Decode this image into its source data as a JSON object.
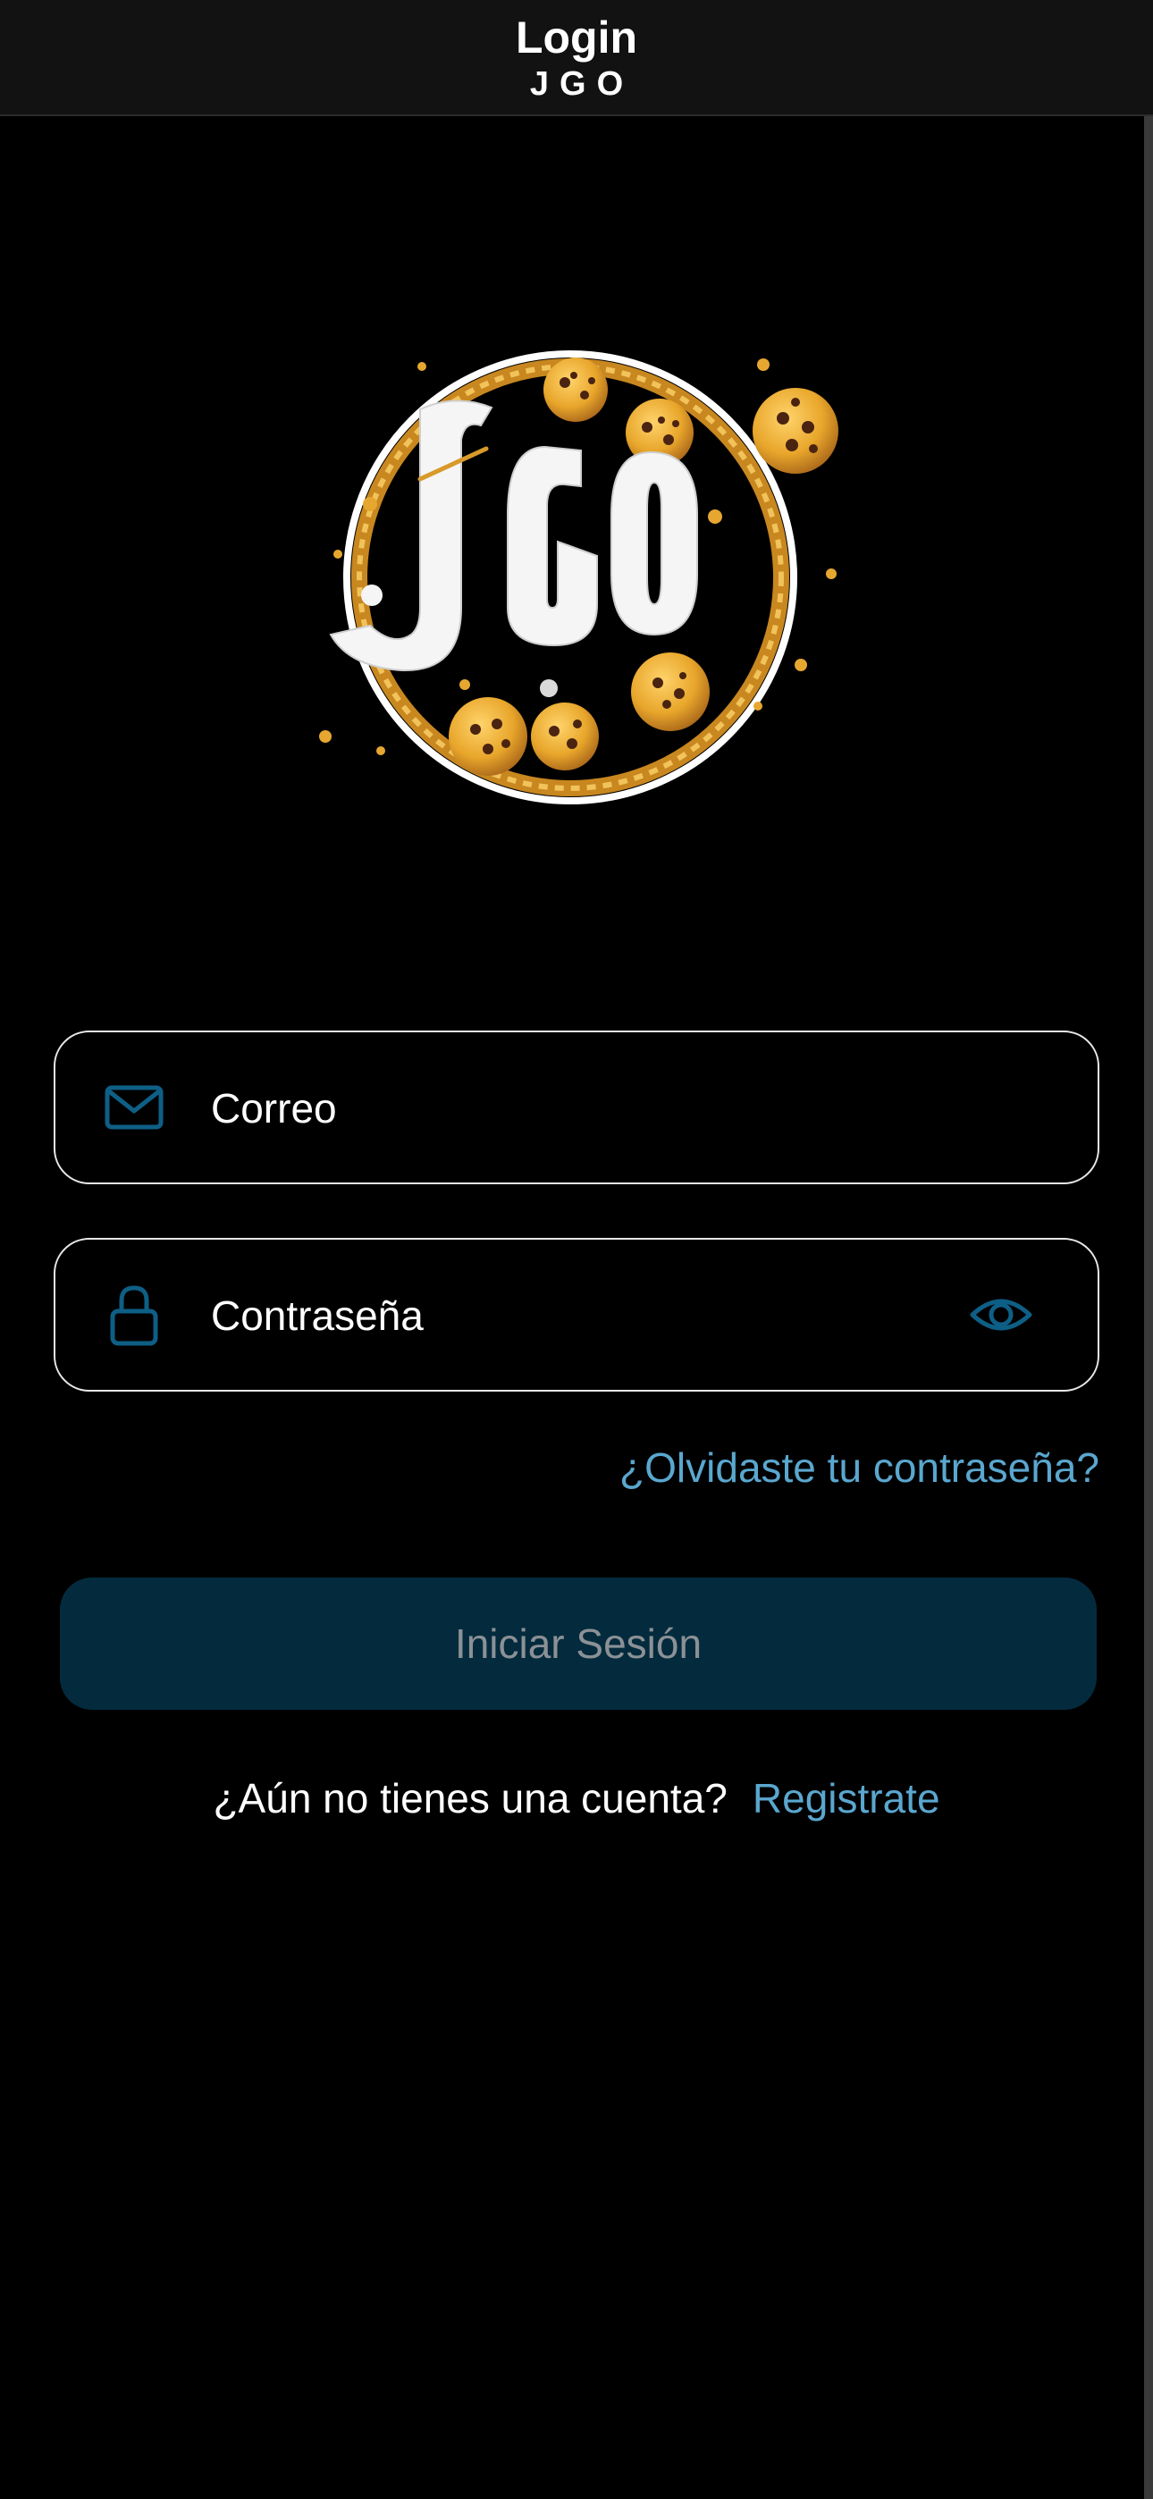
{
  "header": {
    "title": "Login",
    "subtitle": "JGO"
  },
  "logo": {
    "text": "JGO",
    "icon": "cookie-ring-logo"
  },
  "form": {
    "email": {
      "placeholder": "Correo",
      "value": "",
      "icon": "mail-icon"
    },
    "password": {
      "placeholder": "Contraseña",
      "value": "",
      "icon": "lock-icon",
      "toggle_icon": "eye-icon"
    },
    "forgot_password": "¿Olvidaste tu contraseña?",
    "submit_label": "Iniciar Sesión"
  },
  "signup": {
    "prompt": "¿Aún no tienes una cuenta?",
    "link": "Registrate"
  },
  "colors": {
    "background": "#000000",
    "header_bg": "#121212",
    "accent": "#5aa7cf",
    "icon": "#0e5f86",
    "button_bg": "#042b3d",
    "button_text": "#8b9196"
  }
}
